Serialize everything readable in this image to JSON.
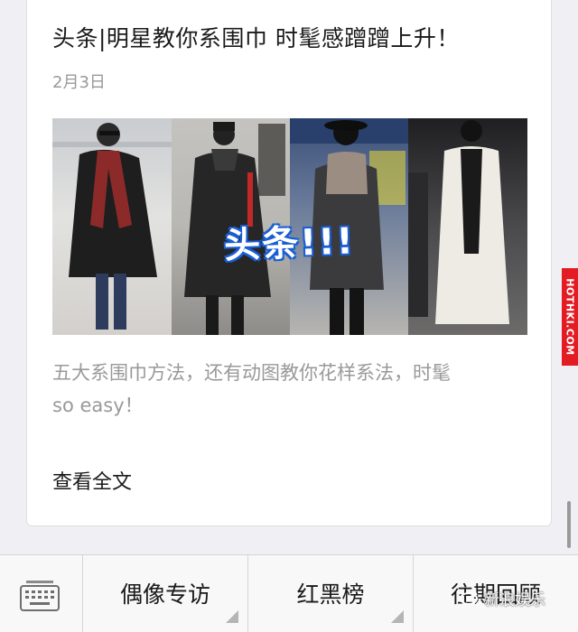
{
  "article": {
    "title": "头条|明星教你系围巾 时髦感蹭蹭上升！",
    "date": "2月3日",
    "image_overlay_text": "头条!!!",
    "summary_line1": "五大系围巾方法，还有动图教你花样系法，时髦",
    "summary_line2": "so easy！",
    "read_more": "查看全文"
  },
  "watermark": {
    "side_text": "HOTHKI.COM",
    "bottom_text": "新浪娱乐"
  },
  "bottom_menu": {
    "keyboard_icon": "keyboard-icon",
    "items": [
      {
        "label": "偶像专访"
      },
      {
        "label": "红黑榜"
      },
      {
        "label": "往期回顾"
      }
    ]
  },
  "colors": {
    "background": "#efeff4",
    "watermark_red": "#e31b23",
    "overlay_blue": "#1a5fd4"
  }
}
